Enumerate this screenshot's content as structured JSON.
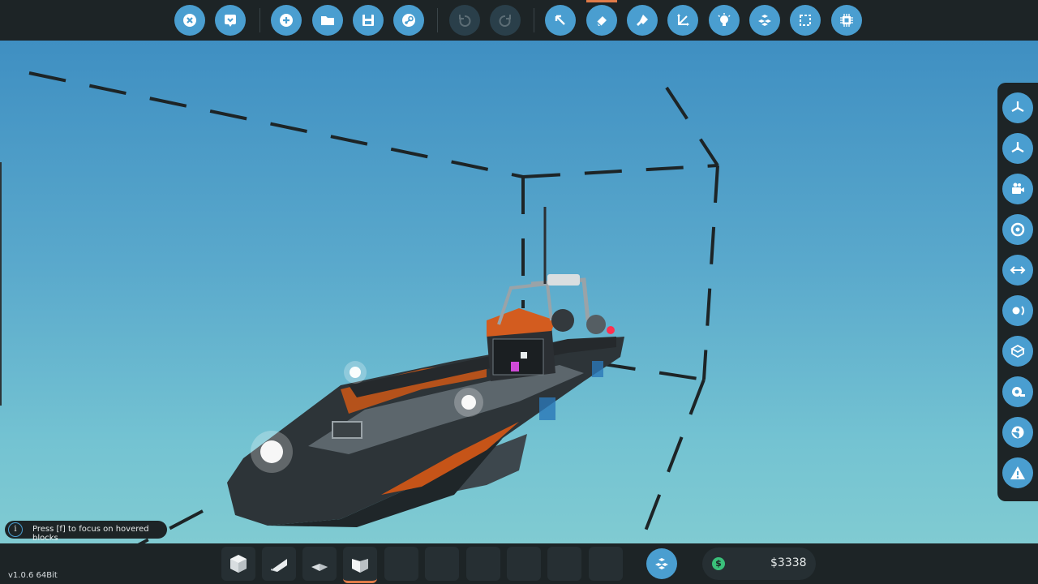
{
  "topbar": {
    "buttons": [
      {
        "icon": "close-icon",
        "label": "Close"
      },
      {
        "icon": "dropdown-icon",
        "label": "Menu"
      },
      {
        "icon": "new-icon",
        "label": "New"
      },
      {
        "icon": "folder-icon",
        "label": "Open"
      },
      {
        "icon": "save-icon",
        "label": "Save"
      },
      {
        "icon": "steam-icon",
        "label": "Workshop"
      },
      {
        "icon": "undo-icon",
        "label": "Undo"
      },
      {
        "icon": "redo-icon",
        "label": "Redo"
      },
      {
        "icon": "select-cursor-icon",
        "label": "Select"
      },
      {
        "icon": "eraser-icon",
        "label": "Erase"
      },
      {
        "icon": "paint-icon",
        "label": "Paint"
      },
      {
        "icon": "axis-icon",
        "label": "Move"
      },
      {
        "icon": "light-bulb-icon",
        "label": "Lights"
      },
      {
        "icon": "blocks-icon",
        "label": "Components"
      },
      {
        "icon": "selection-box-icon",
        "label": "Box Select"
      },
      {
        "icon": "microprocessor-icon",
        "label": "Microprocessor"
      }
    ],
    "active_tool": "Erase"
  },
  "rightbar": {
    "buttons": [
      "rotor-icon",
      "rotor-alt-icon",
      "camera-icon",
      "target-icon",
      "logic-arrows-icon",
      "ball-icon",
      "box-icon",
      "tape-icon",
      "sphere-icon",
      "warning-icon"
    ]
  },
  "bottombar": {
    "slots": [
      {
        "icon": "cube-block-icon",
        "filled": true
      },
      {
        "icon": "wedge-block-icon",
        "filled": true
      },
      {
        "icon": "pyramid-block-icon",
        "filled": true
      },
      {
        "icon": "slope-block-icon",
        "filled": true,
        "selected": true
      },
      {
        "filled": false
      },
      {
        "filled": false
      },
      {
        "filled": false
      },
      {
        "filled": false
      },
      {
        "filled": false
      },
      {
        "filled": false
      }
    ],
    "inventory_icon": "blocks-icon",
    "money": "$3338",
    "currency_symbol": "$"
  },
  "hint": {
    "text": "Press [f] to focus on hovered blocks",
    "icon": "i"
  },
  "version": "v1.0.6 64Bit",
  "colors": {
    "accent": "#4a9ed0",
    "bar": "#1d2426",
    "highlight": "#e07b48"
  }
}
